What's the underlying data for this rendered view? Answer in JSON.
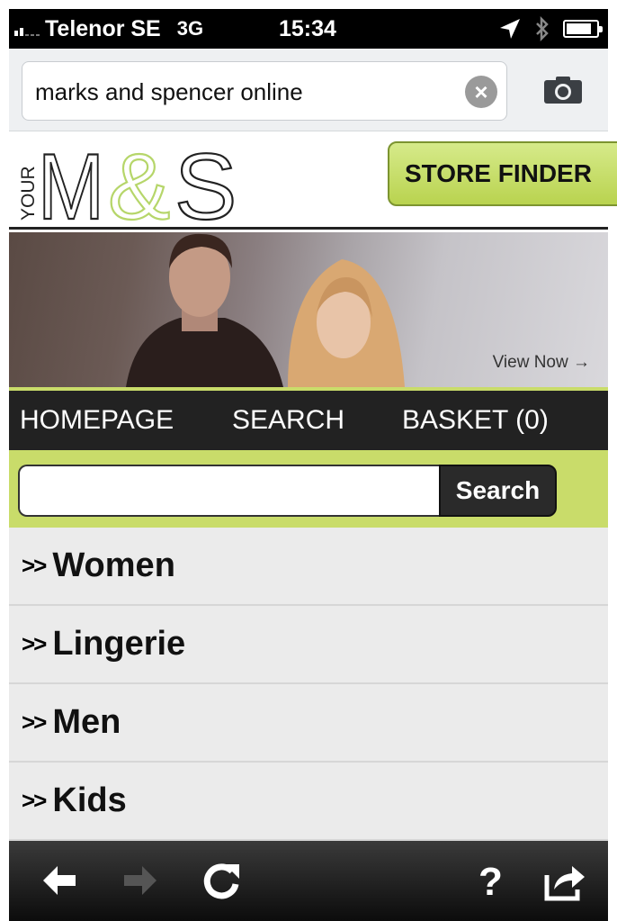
{
  "status_bar": {
    "carrier": "Telenor SE",
    "network": "3G",
    "time": "15:34",
    "signal_bars": 2,
    "battery_level": 0.85,
    "icons": [
      "location-arrow-icon",
      "bluetooth-icon",
      "battery-icon"
    ]
  },
  "address_bar": {
    "url_text": "marks and spencer online",
    "clear_icon": "clear-icon",
    "camera_icon": "camera-icon"
  },
  "header": {
    "logo_your": "YOUR",
    "logo_m": "M",
    "logo_amp": "&",
    "logo_s": "S",
    "store_finder": "STORE FINDER"
  },
  "banner": {
    "view_now": "View Now →"
  },
  "nav": {
    "homepage": "HOMEPAGE",
    "search": "SEARCH",
    "basket": "BASKET (0)"
  },
  "search": {
    "value": "",
    "placeholder": "",
    "button": "Search"
  },
  "categories": [
    {
      "arrow": ">>",
      "label": "Women"
    },
    {
      "arrow": ">>",
      "label": "Lingerie"
    },
    {
      "arrow": ">>",
      "label": "Men"
    },
    {
      "arrow": ">>",
      "label": "Kids"
    }
  ],
  "toolbar": {
    "icons": [
      "back-arrow-icon",
      "forward-arrow-icon",
      "reload-icon",
      "help-icon",
      "share-icon"
    ]
  },
  "colors": {
    "accent_green": "#c9dc6a",
    "nav_dark": "#222222"
  }
}
